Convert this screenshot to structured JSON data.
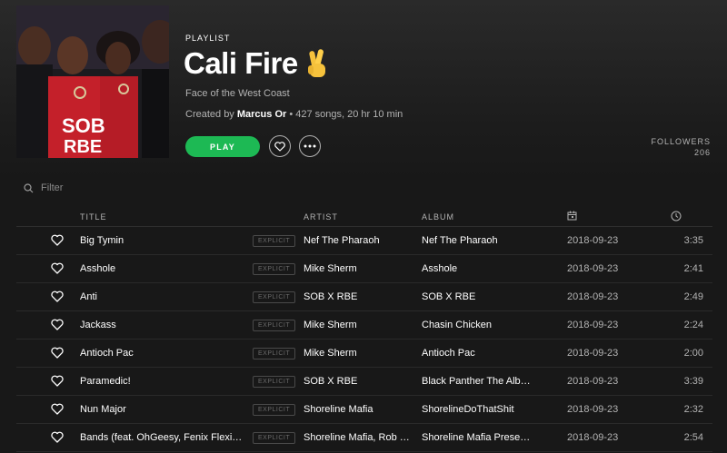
{
  "header": {
    "type_label": "PLAYLIST",
    "title": "Cali Fire",
    "emoji": "crossed-fingers-emoji",
    "description": "Face of the West Coast",
    "created_by_prefix": "Created by",
    "owner": "Marcus Or",
    "stats": "• 427 songs, 20 hr 10 min",
    "play_label": "PLAY",
    "followers_label": "FOLLOWERS",
    "followers_count": "206"
  },
  "filter": {
    "placeholder": "Filter"
  },
  "columns": {
    "title": "TITLE",
    "artist": "ARTIST",
    "album": "ALBUM",
    "date_icon": "calendar-icon",
    "duration_icon": "clock-icon"
  },
  "explicit_label": "EXPLICIT",
  "colors": {
    "accent": "#1db954",
    "background": "#181818",
    "muted_text": "#b3b3b3"
  },
  "tracks": [
    {
      "title": "Big Tymin",
      "explicit": true,
      "artist": "Nef The Pharaoh",
      "album": "Nef The Pharaoh",
      "date": "2018-09-23",
      "duration": "3:35"
    },
    {
      "title": "Asshole",
      "explicit": true,
      "artist": "Mike Sherm",
      "album": "Asshole",
      "date": "2018-09-23",
      "duration": "2:41"
    },
    {
      "title": "Anti",
      "explicit": true,
      "artist": "SOB X RBE",
      "album": "SOB X RBE",
      "date": "2018-09-23",
      "duration": "2:49"
    },
    {
      "title": "Jackass",
      "explicit": true,
      "artist": "Mike Sherm",
      "album": "Chasin Chicken",
      "date": "2018-09-23",
      "duration": "2:24"
    },
    {
      "title": "Antioch Pac",
      "explicit": true,
      "artist": "Mike Sherm",
      "album": "Antioch Pac",
      "date": "2018-09-23",
      "duration": "2:00"
    },
    {
      "title": "Paramedic!",
      "explicit": true,
      "artist": "SOB X RBE",
      "album": "Black Panther The Alb…",
      "date": "2018-09-23",
      "duration": "3:39"
    },
    {
      "title": "Nun Major",
      "explicit": true,
      "artist": "Shoreline Mafia",
      "album": "ShorelineDoThatShit",
      "date": "2018-09-23",
      "duration": "2:32"
    },
    {
      "title": "Bands (feat. OhGeesy, Fenix Flexi…",
      "explicit": true,
      "artist": "Shoreline Mafia, Rob …",
      "album": "Shoreline Mafia Prese…",
      "date": "2018-09-23",
      "duration": "2:54"
    }
  ]
}
